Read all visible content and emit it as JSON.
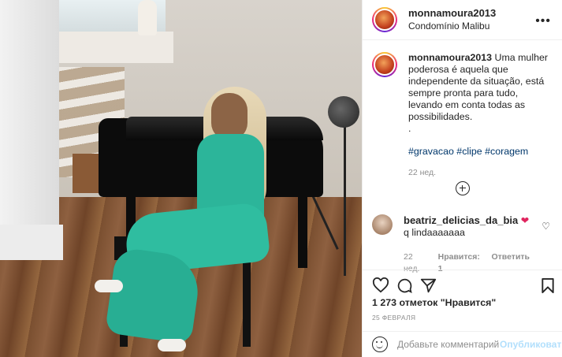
{
  "post": {
    "username": "monnamoura2013",
    "location": "Condomínio Malibu",
    "more_icon": "more-horizontal-icon"
  },
  "caption": {
    "username": "monnamoura2013",
    "text": "Uma mulher poderosa é aquela que independente da situação, está sempre pronta para tudo, levando em conta todas as possibilidades.",
    "dot": ".",
    "dot2": ".",
    "hashtags": "#gravacao #clipe #coragem",
    "time": "22 нед."
  },
  "comment": {
    "username": "beatriz_delicias_da_bia",
    "heart": "❤",
    "text": "q lindaaaaaaa",
    "time": "22 нед.",
    "likes": "Нравится: 1",
    "reply": "Ответить"
  },
  "actions": {
    "like_icon": "heart-icon",
    "comment_icon": "comment-icon",
    "share_icon": "share-icon",
    "save_icon": "bookmark-icon"
  },
  "likes_text": "1 273 отметок \"Нравится\"",
  "date": "25 ФЕВРАЛЯ",
  "add_comment": {
    "placeholder": "Добавьте комментарий...",
    "publish": "Опубликовать"
  },
  "colors": {
    "link": "#00376b",
    "muted": "#8e8e8e",
    "publish_disabled": "#b2dffc",
    "heart": "#e0245e"
  }
}
